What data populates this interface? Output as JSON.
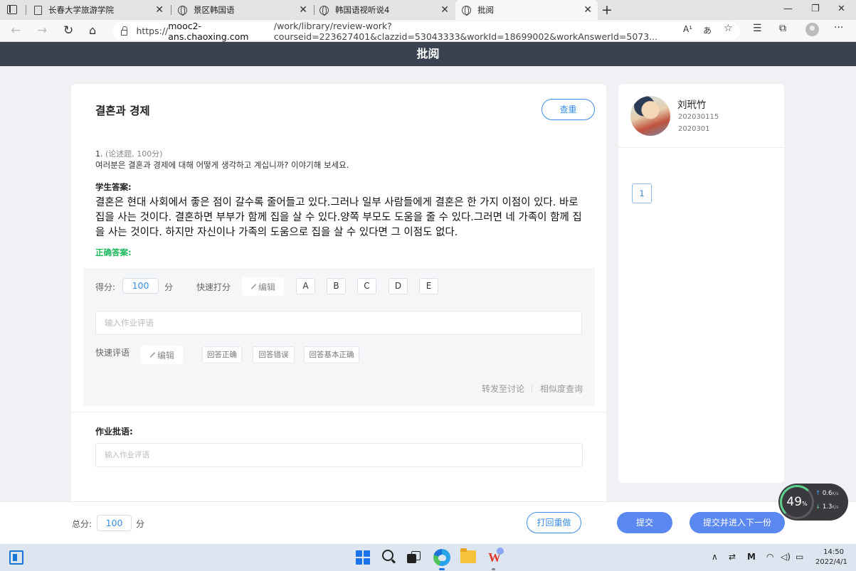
{
  "browser": {
    "tabs": [
      {
        "title": "长春大学旅游学院",
        "icon": "document-icon"
      },
      {
        "title": "景区韩国语",
        "icon": "globe-icon"
      },
      {
        "title": "韩国语视听说4",
        "icon": "globe-icon"
      },
      {
        "title": "批阅",
        "icon": "globe-icon",
        "active": true
      }
    ],
    "url_prefix": "https://",
    "url_host": "mooc2-ans.chaoxing.com",
    "url_path": "/work/library/review-work?courseid=223627401&clazzid=53043333&workId=18699002&workAnswerId=5073...",
    "read_aloud_label": "A¹",
    "translate_label": "あ"
  },
  "page": {
    "header_title": "批阅"
  },
  "homework": {
    "title": "결혼과 경제",
    "check_button": "查重",
    "question_number": "1.",
    "question_type": "(论述题, 100分)",
    "question_text": "여러분은 결혼과 경제에 대해 어떻게 생각하고 계십니까? 이야기해 보세요.",
    "student_answer_label": "学生答案:",
    "student_answer": "결혼은 현대 사회에서 좋은 점이 갈수록 줄어들고 있다.그러나 일부 사람들에게 결혼은 한 가지 이점이 있다. 바로 집을 사는 것이다. 결혼하면 부부가 함께 집을 살 수 있다.양쪽 부모도 도움을 줄 수 있다.그러면 네 가족이 함께 집을 사는 것이다. 하지만 자신이나 가족의 도움으로 집을 살 수 있다면 그 이점도 없다.",
    "correct_answer_label": "正确答案:"
  },
  "grading": {
    "score_label": "得分:",
    "score_value": "100",
    "score_unit": "分",
    "quick_score_label": "快速打分",
    "edit_label": "编辑",
    "grade_letters": [
      "A",
      "B",
      "C",
      "D",
      "E"
    ],
    "comment_placeholder": "输入作业评语",
    "quick_comment_label": "快速评语",
    "quick_comments": [
      "回答正确",
      "回答错误",
      "回答基本正确"
    ],
    "forward_link": "转发至讨论",
    "similarity_link": "相似度查询"
  },
  "homework_comment": {
    "label": "作业批语:",
    "placeholder": "输入作业评语"
  },
  "student": {
    "name": "刘玳竹",
    "id": "202030115",
    "class": "2020301"
  },
  "question_nav": [
    "1"
  ],
  "bottom": {
    "total_label": "总分:",
    "total_value": "100",
    "total_unit": "分",
    "redo_button": "打回重做",
    "submit_button": "提交",
    "submit_next_button": "提交并进入下一份"
  },
  "net_widget": {
    "percent": "49",
    "percent_unit": "%",
    "upload": "0.6",
    "download": "1.3",
    "rate_unit": "K/s"
  },
  "taskbar": {
    "time": "14:50",
    "date": "2022/4/1"
  }
}
